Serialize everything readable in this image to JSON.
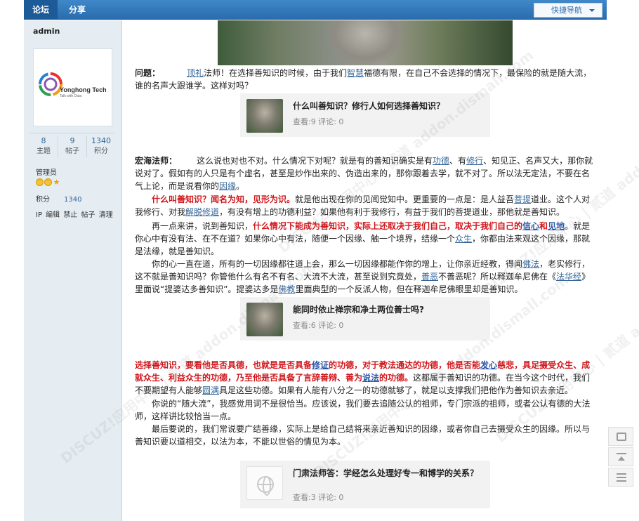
{
  "nav": {
    "tabs": [
      "论坛",
      "分享"
    ],
    "quick_nav": "快捷导航"
  },
  "sidebar": {
    "username": "admin",
    "logo_text": "Yonghong Tech",
    "logo_sub": "Talk with Data",
    "stats": [
      {
        "value": "8",
        "label": "主题"
      },
      {
        "value": "9",
        "label": "帖子"
      },
      {
        "value": "1340",
        "label": "积分"
      }
    ],
    "group": "管理员",
    "points_label": "积分",
    "points_value": "1340",
    "admin_links": "IP 编辑 禁止 帖子 清理"
  },
  "content": {
    "q_prefix": "问题：",
    "q_link1": "顶礼",
    "q_text1": "法师！在选择善知识的时候，由于我们",
    "q_link2": "智慧",
    "q_text2": "福德有限，在自己不会选择的情况下，最保险的就是随大流，谁的名声大跟谁学。这样对吗？",
    "a_speaker": "宏海法师：",
    "a1_t1": "这么说也对也不对。什么情况下对呢？就是有的善知识确实是有",
    "a1_l1": "功德",
    "a1_t2": "、有",
    "a1_l2": "修行",
    "a1_t3": "、知见正、名声又大，那你就说对了。假如有的人只是有个虚名，甚至是炒作出来的、伪造出来的，那你跟着去学，就不对了。所以法无定法，不要在名气上论，而是说看你的",
    "a1_l3": "因缘",
    "a1_t4": "。",
    "a2_red": "什么叫善知识？闻名为知，见形为识。",
    "a2_t1": "就是他出现在你的见闻觉知中。更重要的一点是：是人益吾",
    "a2_l1": "菩提",
    "a2_t2": "道业。这个人对我修行、对我",
    "a2_l2": "解脱修道",
    "a2_t3": "，有没有增上的功德利益？如果他有利于我修行，有益于我们的菩提道业，那他就是善知识。",
    "a3_t1": "再一点来讲，说到善知识，",
    "a3_red": "什么情况下能成为善知识，实际上还取决于我们自己，取决于我们自己的",
    "a3_l1": "信心",
    "a3_red2": "和",
    "a3_l2": "见地",
    "a3_t2": "。就是你心中有没有法、在不在道？如果你心中有法，随便一个因缘、触一个境界，结缘一个",
    "a3_l3": "众生",
    "a3_t3": "，你都由法来观这个因缘，那就是法缘，就是善知识。",
    "a4_t1": "你的心一直在道，所有的一切因缘都往道上会，那么一切因缘都能作你的增上，让你亲近经教，得闻",
    "a4_l1": "佛法",
    "a4_t2": "，老实修行，这不就是善知识吗？你管他什么有名不有名、大流不大流，甚至说到究竟处，",
    "a4_l2": "善恶",
    "a4_t3": "不善恶呢？所以释迦牟尼佛在《",
    "a4_l3": "法华经",
    "a4_t4": "》里面说“提婆达多善知识”。提婆达多是",
    "a4_l4": "佛教",
    "a4_t5": "里面典型的一个反派人物，但在释迦牟尼佛眼里却是善知识。",
    "a5_red1": "选择善知识，要看他是否具德，也就是是否具备",
    "a5_l1": "修证",
    "a5_red2": "的功德，对于教法通达的功德，他是否能",
    "a5_l2": "发心",
    "a5_red3": "慈悲，具足摄受众生、成就众生、利益众生的功德，乃至他是否具备了言辞善辩、善为",
    "a5_l3": "说法",
    "a5_red4": "的功德。",
    "a5_t1": "这都属于善知识的功德。在当今这个时代，我们不要期望有人能够",
    "a5_l4": "圆满",
    "a5_t2": "具足这些功德。如果有人能有八分之一的功德就够了，就足以支撑我们把他作为善知识去亲近。",
    "a6": "你说的“随大流”，我感觉用词不是很恰当。应该说，我们要去追随公认的祖师，专门宗派的祖师，或者公认有德的大法师，这样讲比较恰当一点。",
    "a7": "最后要说的，我们常说要广结善缘，实际上是给自己结将来亲近善知识的因缘，或者你自己去摄受众生的因缘。所以与善知识要以道相交，以法为本，不能以世俗的情见为本。"
  },
  "cards": [
    {
      "title": "什么叫善知识？修行人如何选择善知识？",
      "meta": "查看:9 评论: 0"
    },
    {
      "title": "能同时依止禅宗和净土两位善士吗?",
      "meta": "查看:6 评论: 0"
    },
    {
      "title": "门肃法师答：学经怎么处理好专一和博学的关系？",
      "meta": "查看:3 评论: 0"
    }
  ],
  "watermark": "DISCUZ!应用中心 | 贰道 addon.dismall.com",
  "colors": {
    "nav": "#2a6cae",
    "sidebar": "#e5edf2",
    "highlight_red": "#d0161b",
    "link": "#336699"
  }
}
